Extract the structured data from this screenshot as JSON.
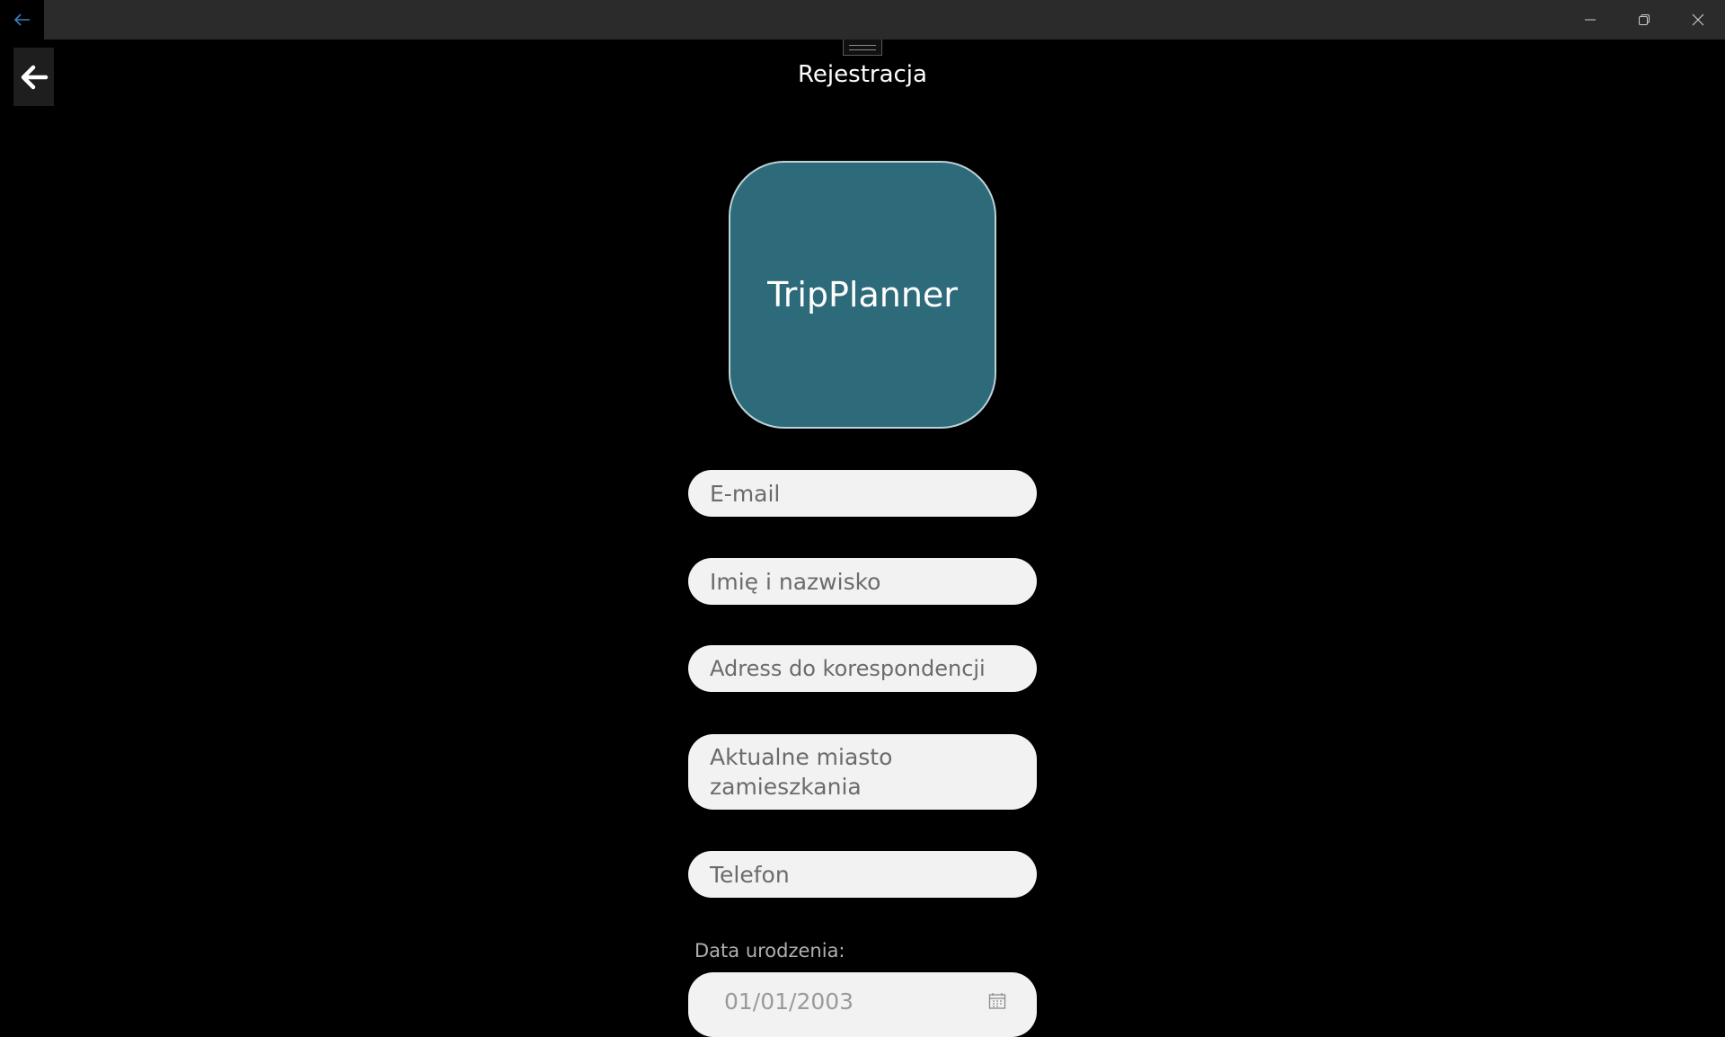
{
  "window": {
    "title_back_icon": "arrow-left-icon",
    "controls": {
      "minimize_icon": "minimize-icon",
      "maximize_icon": "restore-icon",
      "close_icon": "close-icon"
    }
  },
  "header": {
    "back_icon": "arrow-left-icon",
    "title": "Rejestracja"
  },
  "logo": {
    "text": "TripPlanner",
    "bg_color": "#2d6a7a"
  },
  "form": {
    "email_placeholder": "E-mail",
    "name_placeholder": "Imię i nazwisko",
    "address_placeholder": "Adress do korespondencji",
    "city_placeholder": "Aktualne miasto zamieszkania",
    "phone_placeholder": "Telefon",
    "dob_label": "Data urodzenia:",
    "dob_value": "01/01/2003",
    "dob_icon": "calendar-icon"
  }
}
